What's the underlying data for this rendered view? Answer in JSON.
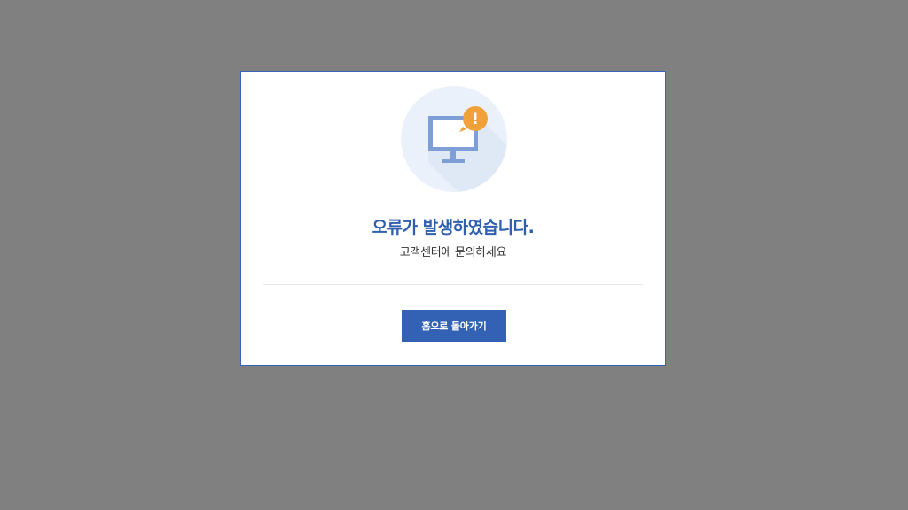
{
  "dialog": {
    "icon": "monitor-alert-icon",
    "alert_badge_text": "!",
    "title": "오류가 발생하였습니다.",
    "subtitle": "고객센터에 문의하세요",
    "home_button_label": "홈으로 돌아가기"
  },
  "colors": {
    "backdrop": "#808080",
    "dialog_border": "#3a63b8",
    "title": "#2f5fad",
    "button_bg": "#3361b3",
    "icon_circle": "#eaf1fa",
    "monitor": "#7e9fd6",
    "alert_badge": "#f0a13a"
  }
}
